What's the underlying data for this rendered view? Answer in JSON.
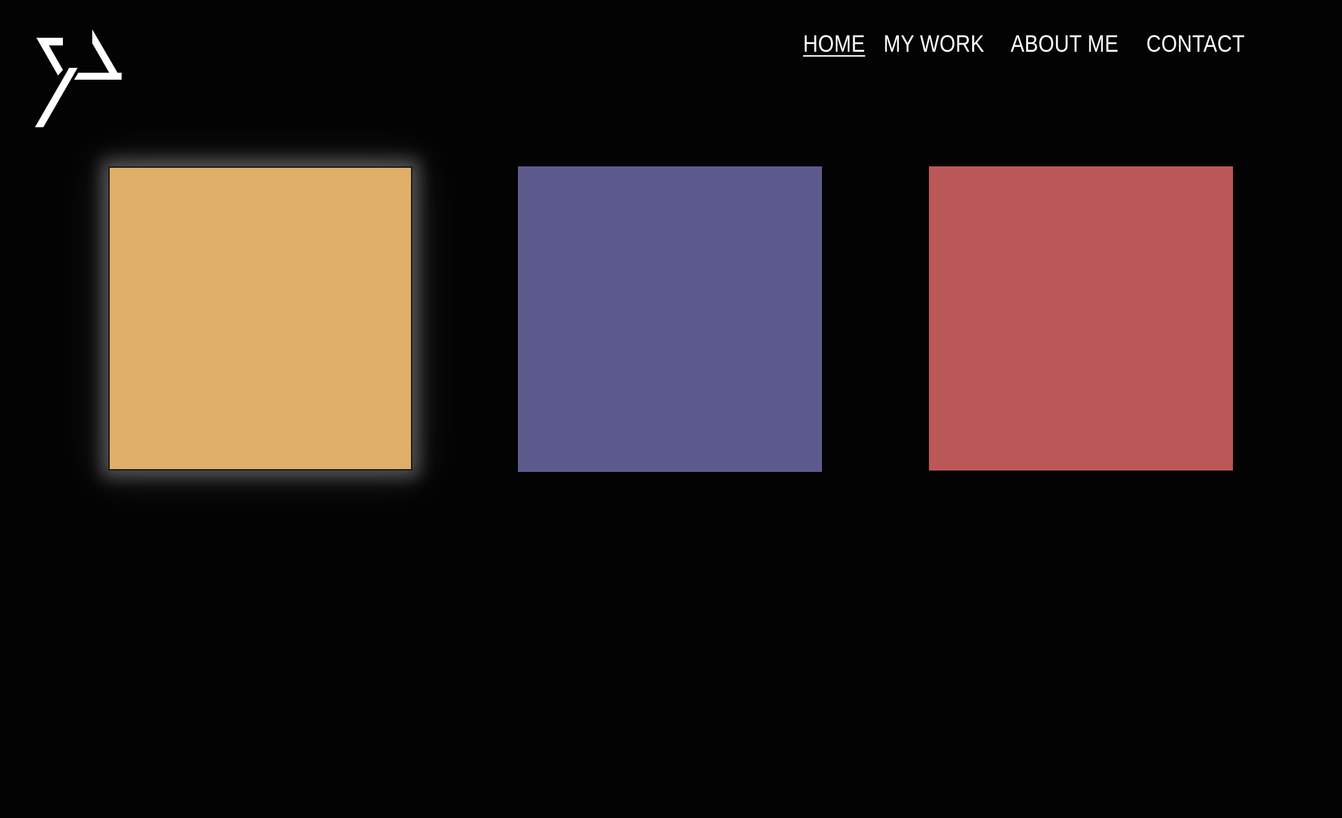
{
  "logo": {
    "icon": "yp-monogram-logo",
    "color": "#ffffff"
  },
  "nav": {
    "items": [
      {
        "label": "HOME",
        "active": true
      },
      {
        "label": "MY WORK",
        "active": false
      },
      {
        "label": "ABOUT ME",
        "active": false
      },
      {
        "label": "CONTACT",
        "active": false
      }
    ]
  },
  "tiles": [
    {
      "color": "#dfae69",
      "highlighted": true
    },
    {
      "color": "#5d5b8e",
      "highlighted": false
    },
    {
      "color": "#bc5757",
      "highlighted": false
    }
  ],
  "theme": {
    "background": "#030303",
    "text": "#ffffff"
  }
}
